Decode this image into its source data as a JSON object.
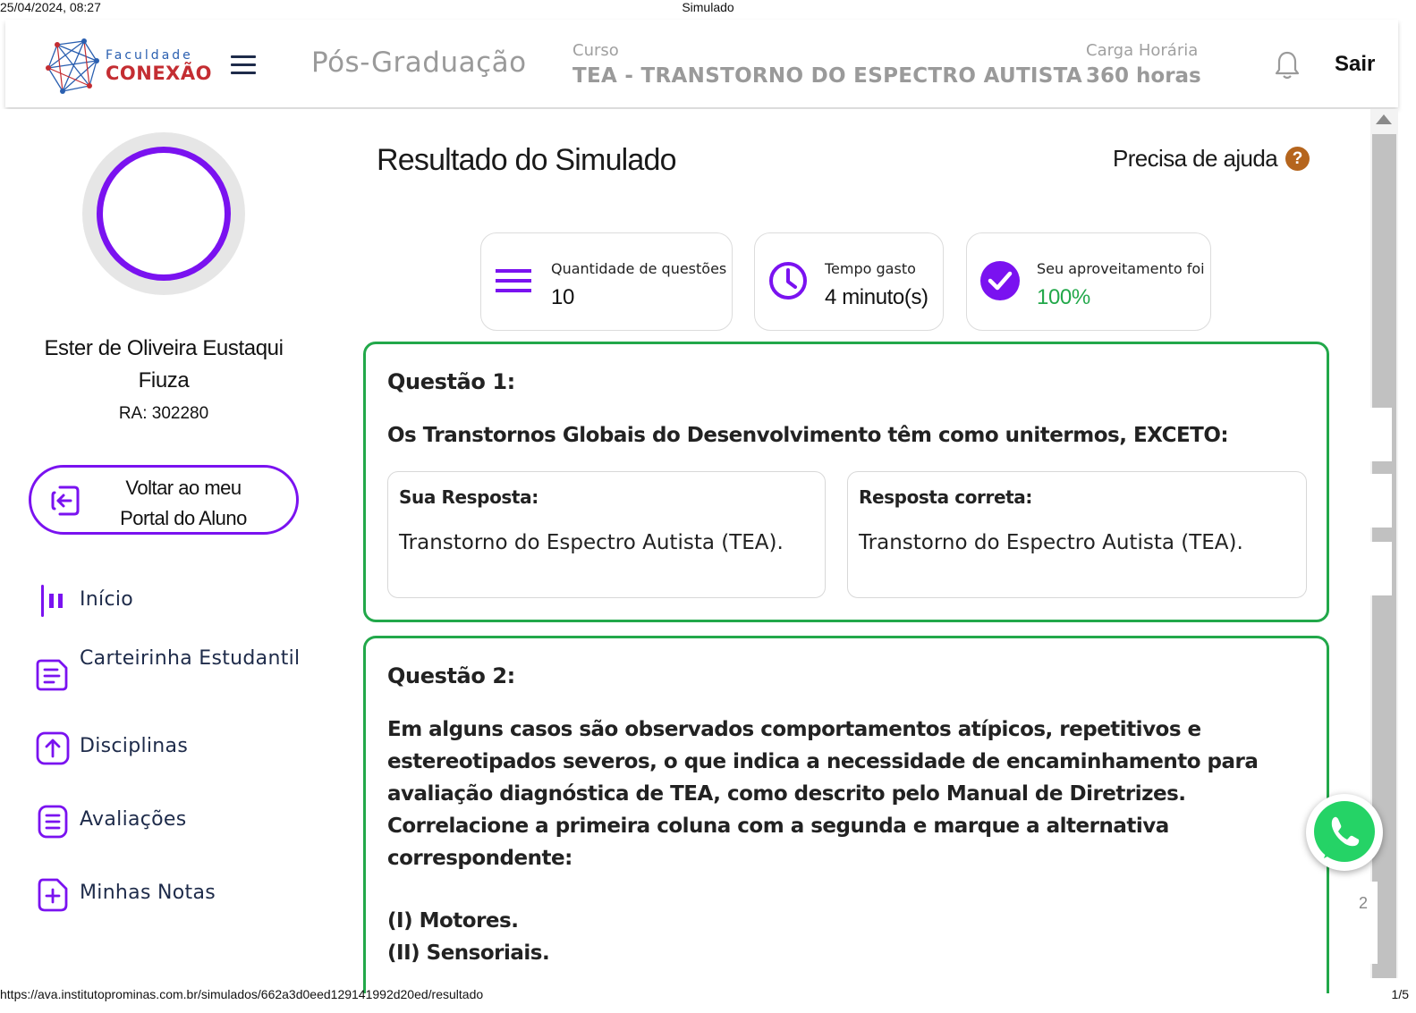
{
  "print": {
    "date": "25/04/2024, 08:27",
    "title": "Simulado",
    "url": "https://ava.institutoprominas.com.br/simulados/662a3d0eed129141992d20ed/resultado",
    "page": "1/5"
  },
  "header": {
    "logo_top": "Faculdade",
    "logo_main": "CONEXÃO",
    "program": "Pós-Graduação",
    "course_label": "Curso",
    "course_name": "TEA - TRANSTORNO DO ESPECTRO AUTISTA",
    "hours_label": "Carga Horária",
    "hours_value": "360 horas",
    "logout": "Sair"
  },
  "sidebar": {
    "student_name": "Ester de Oliveira Eustaqui Fiuza",
    "student_ra": "RA: 302280",
    "back_button": "Voltar ao meu Portal do Aluno",
    "nav": [
      {
        "label": "Início",
        "icon": "bar-chart-icon"
      },
      {
        "label": "Carteirinha Estudantil",
        "icon": "student-card-icon"
      },
      {
        "label": "Disciplinas",
        "icon": "upload-arrow-icon"
      },
      {
        "label": "Avaliações",
        "icon": "list-document-icon"
      },
      {
        "label": "Minhas Notas",
        "icon": "plus-document-icon"
      }
    ]
  },
  "main": {
    "title": "Resultado do Simulado",
    "help": "Precisa de ajuda",
    "help_icon": "?",
    "stats": [
      {
        "label": "Quantidade de questões",
        "value": "10",
        "icon": "list-icon"
      },
      {
        "label": "Tempo gasto",
        "value": "4 minuto(s)",
        "icon": "clock-icon"
      },
      {
        "label": "Seu aproveitamento foi",
        "value": "100%",
        "icon": "check-circle-icon"
      }
    ],
    "questions": [
      {
        "title": "Questão 1:",
        "text": "Os Transtornos Globais do Desenvolvimento têm como unitermos, EXCETO:",
        "your_answer_label": "Sua Resposta:",
        "your_answer": "Transtorno do Espectro Autista (TEA).",
        "correct_answer_label": "Resposta correta:",
        "correct_answer": "Transtorno do Espectro Autista (TEA)."
      },
      {
        "title": "Questão 2:",
        "text": "Em alguns casos são observados comportamentos atípicos, repetitivos e estereotipados severos, o que indica a necessidade de encaminhamento para avaliação diagnóstica de TEA, como descrito pelo Manual de Diretrizes. Correlacione a primeira coluna com a segunda e marque a alternativa correspondente:",
        "items": [
          "(I) Motores.",
          "(II) Sensoriais."
        ]
      }
    ]
  },
  "scroll": {
    "page_indicator": "2"
  },
  "colors": {
    "accent": "#7a12f0",
    "success": "#22a84a",
    "help": "#b5651d",
    "logo_red": "#c42d32",
    "logo_blue": "#2a5fb0"
  }
}
